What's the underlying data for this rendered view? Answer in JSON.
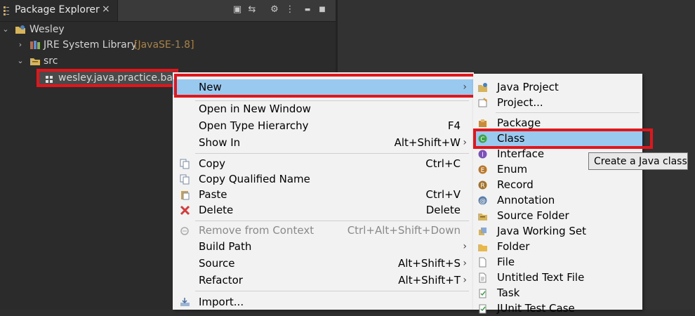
{
  "view": {
    "title": "Package Explorer",
    "close_glyph": "×"
  },
  "toolbar": [
    {
      "name": "collapse-all-icon",
      "glyph": "▣"
    },
    {
      "name": "link-with-editor-icon",
      "glyph": "⇆"
    },
    {
      "name": "filters-icon",
      "glyph": "⚙"
    },
    {
      "name": "view-menu-icon",
      "glyph": "⋮"
    },
    {
      "name": "minimize-icon",
      "glyph": "▬"
    },
    {
      "name": "maximize-icon",
      "glyph": "■"
    }
  ],
  "tree": {
    "project": "Wesley",
    "library": "JRE System Library",
    "library_suffix": "[JavaSE-1.8]",
    "src": "src",
    "package": "wesley.java.practice.basic"
  },
  "context_menu": {
    "new": "New",
    "open_new_window": "Open in New Window",
    "open_type_hierarchy": "Open Type Hierarchy",
    "open_type_hierarchy_acc": "F4",
    "show_in": "Show In",
    "show_in_acc": "Alt+Shift+W",
    "copy": "Copy",
    "copy_acc": "Ctrl+C",
    "copy_qualified": "Copy Qualified Name",
    "paste": "Paste",
    "paste_acc": "Ctrl+V",
    "delete": "Delete",
    "delete_acc": "Delete",
    "remove_context": "Remove from Context",
    "remove_context_acc": "Ctrl+Alt+Shift+Down",
    "build_path": "Build Path",
    "source": "Source",
    "source_acc": "Alt+Shift+S",
    "refactor": "Refactor",
    "refactor_acc": "Alt+Shift+T",
    "import": "Import..."
  },
  "new_submenu": {
    "java_project": "Java Project",
    "project": "Project...",
    "package": "Package",
    "class": "Class",
    "interface": "Interface",
    "enum": "Enum",
    "record": "Record",
    "annotation": "Annotation",
    "source_folder": "Source Folder",
    "java_working_set": "Java Working Set",
    "folder": "Folder",
    "file": "File",
    "untitled_text_file": "Untitled Text File",
    "task": "Task",
    "junit_test_case": "JUnit Test Case"
  },
  "tooltip": "Create a Java class",
  "colors": {
    "highlight": "#99c9ef",
    "annotation_red": "#e0161c"
  }
}
